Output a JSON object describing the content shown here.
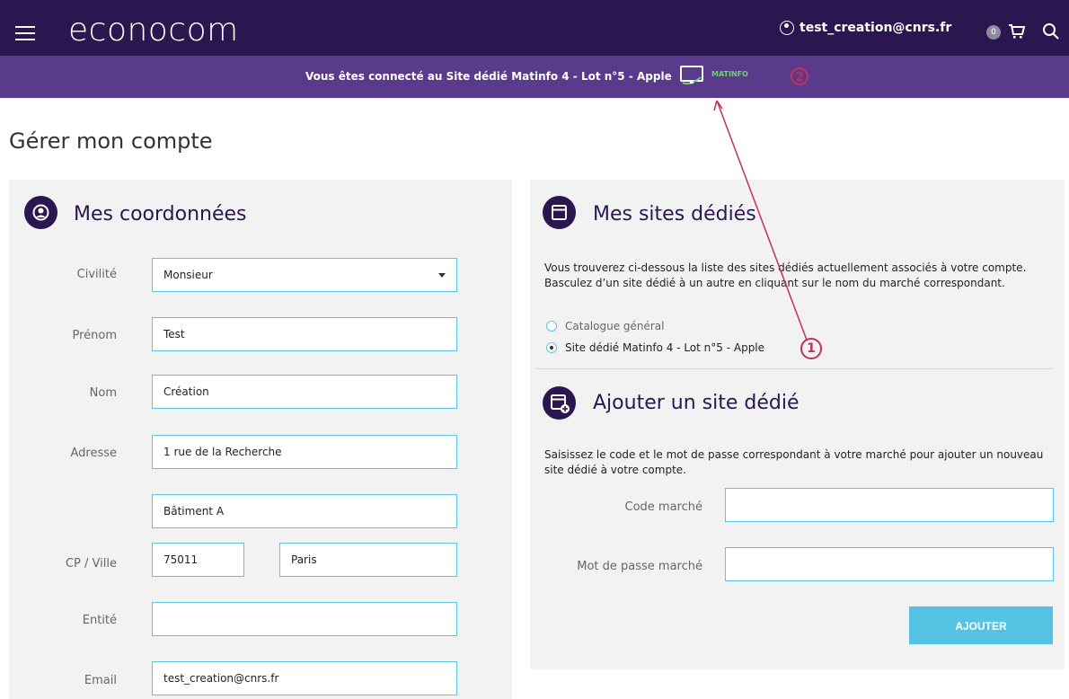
{
  "header": {
    "logo": "econocom",
    "account_email": "test_creation@cnrs.fr",
    "cart_count": "0",
    "icons": [
      "hamburger-icon",
      "user-icon",
      "cart-icon",
      "search-icon"
    ]
  },
  "banner": {
    "text": "Vous êtes connecté au Site dédié Matinfo 4 - Lot n°5 - Apple",
    "logo_label": "MATINFO",
    "annotation": "2"
  },
  "page": {
    "title": "Gérer mon compte"
  },
  "coordonnees": {
    "title": "Mes coordonnées",
    "fields": {
      "civilite": {
        "label": "Civilité",
        "value": "Monsieur"
      },
      "prenom": {
        "label": "Prénom",
        "value": "Test"
      },
      "nom": {
        "label": "Nom",
        "value": "Création"
      },
      "adresse": {
        "label": "Adresse",
        "value1": "1 rue de la Recherche",
        "value2": "Bâtiment A"
      },
      "cp_ville": {
        "label": "CP / Ville",
        "cp": "75011",
        "ville": "Paris"
      },
      "entite": {
        "label": "Entité",
        "value": ""
      },
      "email": {
        "label": "Email",
        "value": "test_creation@cnrs.fr"
      }
    }
  },
  "sites": {
    "title": "Mes sites dédiés",
    "description": "Vous trouverez ci-dessous la liste des sites dédiés actuellement associés à votre compte. Basculez d’un site dédié à un autre en cliquant sur le nom du marché correspondant.",
    "options": [
      {
        "label": "Catalogue général",
        "checked": false
      },
      {
        "label": "Site dédié Matinfo 4 - Lot n°5 - Apple",
        "checked": true
      }
    ],
    "annotation": "1"
  },
  "add_site": {
    "title": "Ajouter un site dédié",
    "description": "Saisissez le code et le mot de passe correspondant à votre marché pour ajouter un nouveau site dédié à votre compte.",
    "code_label": "Code marché",
    "password_label": "Mot de passe marché",
    "button_label": "AJOUTER"
  },
  "colors": {
    "header": "#2b1650",
    "banner": "#5a3a8a",
    "accent": "#55c3e3",
    "annotation": "#c0315d"
  }
}
